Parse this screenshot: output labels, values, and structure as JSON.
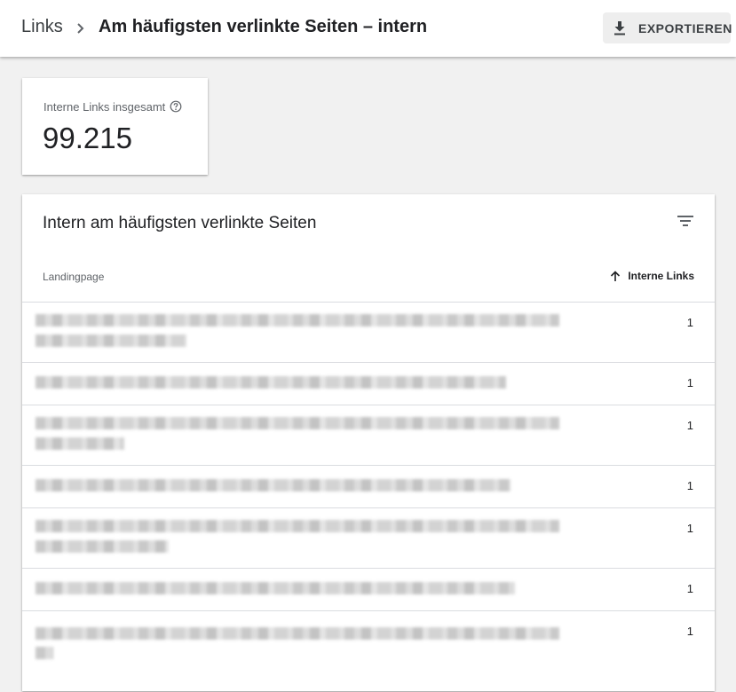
{
  "header": {
    "breadcrumb_root": "Links",
    "title": "Am häufigsten verlinkte Seiten – intern",
    "export_label": "EXPORTIEREN",
    "export_icon": "download-icon",
    "separator_icon": "chevron-right-icon"
  },
  "metric": {
    "label": "Interne Links insgesamt",
    "value": "99.215",
    "help_icon": "help-circle-icon"
  },
  "table": {
    "title": "Intern am häufigsten verlinkte Seiten",
    "filter_icon": "filter-icon",
    "col_landing": "Landingpage",
    "col_links": "Interne Links",
    "sort_icon": "arrow-up-icon",
    "rows": [
      {
        "value": "1"
      },
      {
        "value": "1"
      },
      {
        "value": "1"
      },
      {
        "value": "1"
      },
      {
        "value": "1"
      },
      {
        "value": "1"
      },
      {
        "value": "1"
      }
    ]
  }
}
